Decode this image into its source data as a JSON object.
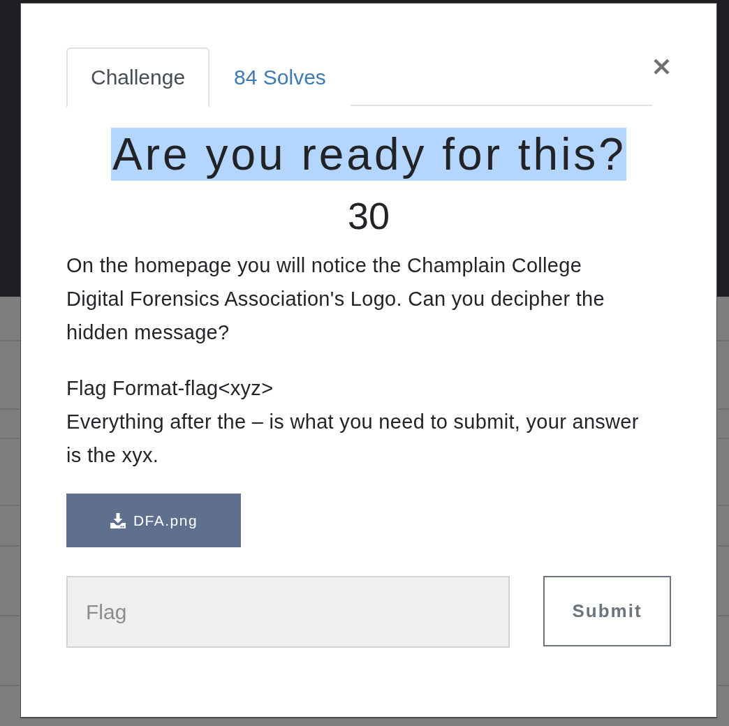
{
  "tabs": [
    {
      "label": "Challenge",
      "selected": true
    },
    {
      "label": "84 Solves",
      "selected": false
    }
  ],
  "challenge": {
    "title": "Are you ready for this?",
    "title_highlighted": true,
    "value": "30",
    "description": [
      {
        "lines": [
          "On the homepage you will notice the Champlain College Digital Forensics Association's Logo. Can you decipher the hidden message?"
        ]
      },
      {
        "lines": [
          "Flag Format-flag<xyz>",
          "Everything after the – is what you need to submit, your answer is the xyx."
        ]
      }
    ],
    "files": [
      {
        "name": "DFA.png"
      }
    ]
  },
  "flag_form": {
    "placeholder": "Flag",
    "submit": "Submit"
  }
}
